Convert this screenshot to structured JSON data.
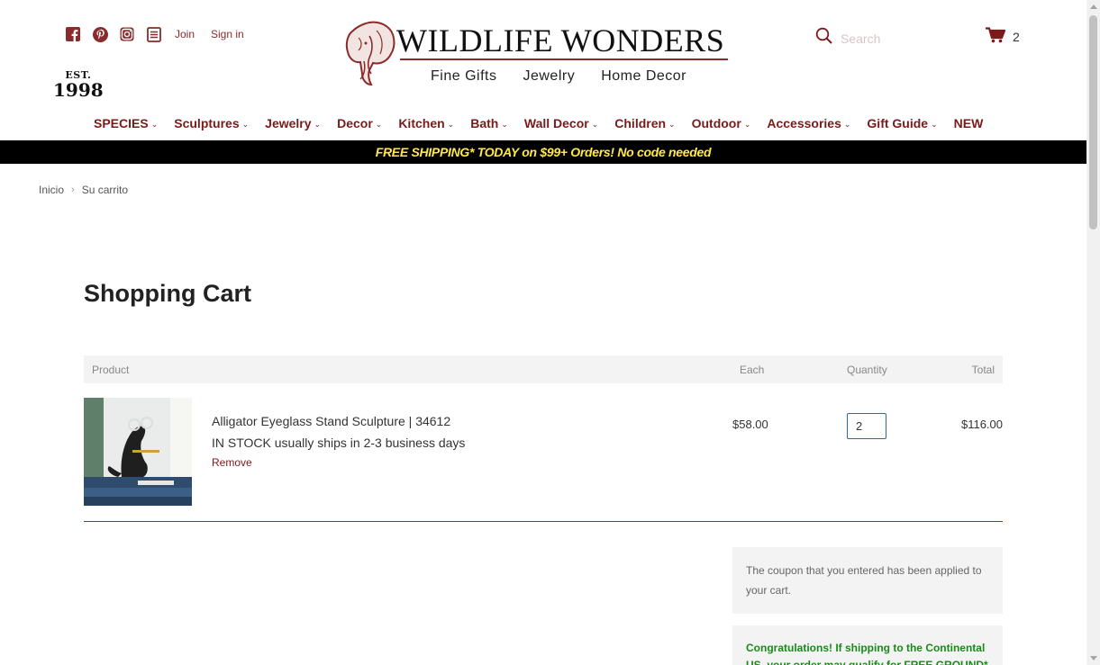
{
  "header": {
    "join_label": "Join",
    "signin_label": "Sign in",
    "est_top": "EST.",
    "est_year": "1998",
    "logo_title": "WILDLIFE WONDERS",
    "logo_sub": [
      "Fine Gifts",
      "Jewelry",
      "Home Decor"
    ],
    "search_placeholder": "Search",
    "cart_count": "2"
  },
  "nav": {
    "items": [
      "SPECIES",
      "Sculptures",
      "Jewelry",
      "Decor",
      "Kitchen",
      "Bath",
      "Wall Decor",
      "Children",
      "Outdoor",
      "Accessories",
      "Gift Guide",
      "NEW"
    ],
    "chevron": "⌄"
  },
  "promo": "FREE SHIPPING* TODAY on $99+ Orders! No code needed",
  "breadcrumb": {
    "home": "Inicio",
    "sep": "›",
    "current": "Su carrito"
  },
  "page_title": "Shopping Cart",
  "table": {
    "headers": {
      "product": "Product",
      "each": "Each",
      "quantity": "Quantity",
      "total": "Total"
    },
    "item": {
      "name": "Alligator Eyeglass Stand Sculpture | 34612",
      "stock": "IN STOCK usually ships in 2-3 business days",
      "remove": "Remove",
      "each": "$58.00",
      "quantity": "2",
      "total": "$116.00"
    }
  },
  "notice": "The coupon that you entered has been applied to your cart.",
  "congrats": "Congratulations! If shipping to the Continental US, your order may qualify for FREE GROUND*",
  "colors": {
    "brand": "#7a1a1a",
    "promo_bg": "#000000",
    "promo_text": "#ffe84a",
    "success": "#1a8a1a"
  }
}
